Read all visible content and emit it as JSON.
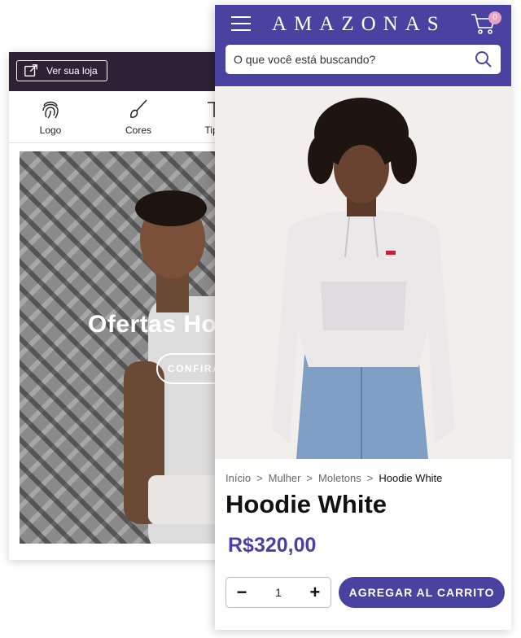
{
  "editor": {
    "view_store_label": "Ver sua loja",
    "tabs": [
      {
        "label": "Logo",
        "icon": "fingerprint-icon"
      },
      {
        "label": "Cores",
        "icon": "paintbrush-icon"
      },
      {
        "label": "Tipo",
        "icon": "typography-icon"
      }
    ],
    "hero": {
      "title": "Ofertas Ho",
      "cta_label": "CONFIRA"
    }
  },
  "store": {
    "brand": "AMAZONAS",
    "cart_count": "0",
    "search_placeholder": "O que você está buscando?",
    "breadcrumb": [
      "Início",
      "Mulher",
      "Moletons",
      "Hoodie White"
    ],
    "breadcrumb_separator": ">",
    "product_title": "Hoodie White",
    "price": "R$320,00",
    "quantity": "1",
    "qty_minus": "−",
    "qty_plus": "+",
    "add_to_cart_label": "AGREGAR AL CARRITO",
    "colors": {
      "brand": "#4a42a0",
      "editor_topbar": "#2d2235",
      "cart_badge": "#e8a3c4"
    }
  }
}
